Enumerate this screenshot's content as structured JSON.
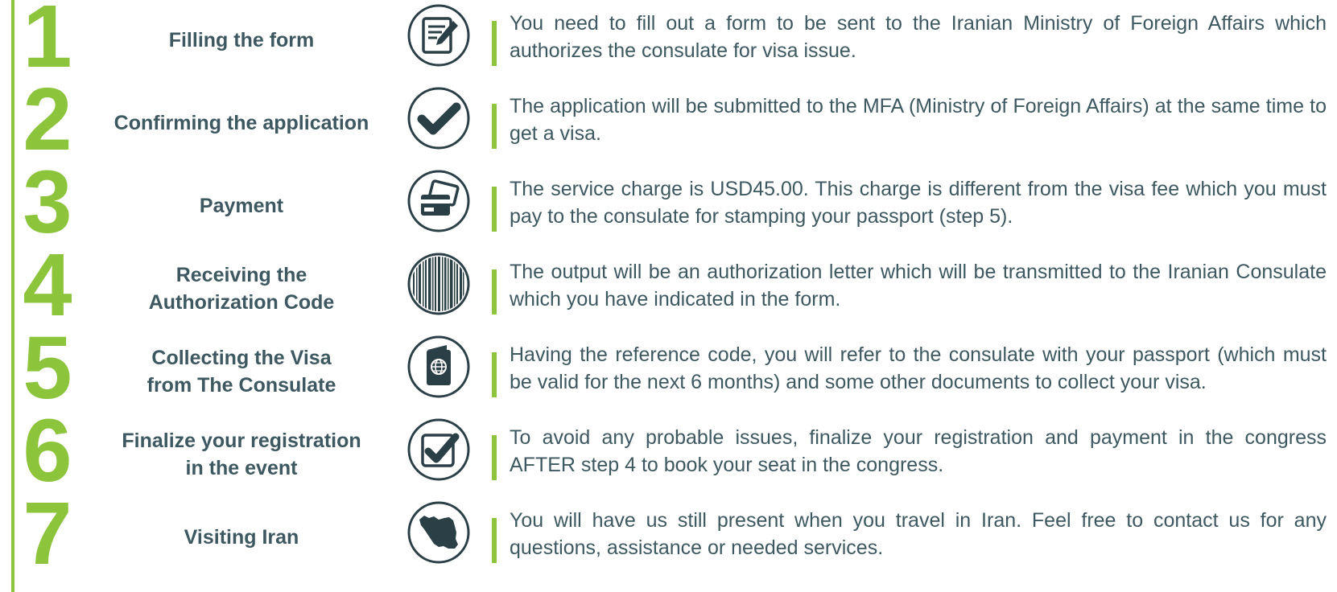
{
  "colors": {
    "accent": "#8cc43c",
    "text": "#3d5860",
    "icon": "#2b3f47"
  },
  "steps": [
    {
      "number": "1",
      "title": "Filling the form",
      "icon": "form-pen-icon",
      "description": "You need to fill out a form to be sent to the Iranian Ministry of Foreign Affairs which authorizes the consulate for visa issue."
    },
    {
      "number": "2",
      "title": "Confirming the application",
      "icon": "checkmark-circle-icon",
      "description": "The application will be submitted to the MFA (Ministry of Foreign Affairs) at the same time to get a visa."
    },
    {
      "number": "3",
      "title": "Payment",
      "icon": "credit-card-icon",
      "description": "The service charge is USD45.00. This charge is different from the visa fee which you must pay to the consulate for stamping your passport (step 5)."
    },
    {
      "number": "4",
      "title": "Receiving the\nAuthorization Code",
      "icon": "barcode-icon",
      "description": "The output will be an authorization letter which will be transmitted to the Iranian Consulate which you have indicated in the form."
    },
    {
      "number": "5",
      "title": "Collecting the Visa\nfrom The Consulate",
      "icon": "passport-icon",
      "description": "Having the reference code, you will refer to the consulate with your passport (which must be valid for the next 6 months) and some other documents to collect your visa."
    },
    {
      "number": "6",
      "title": "Finalize your registration\nin the event",
      "icon": "checkbox-icon",
      "description": "To avoid any probable issues, finalize your registration and payment in the congress AFTER step 4 to book your seat in the congress."
    },
    {
      "number": "7",
      "title": "Visiting Iran",
      "icon": "iran-map-icon",
      "description": "You will have us still present when you travel in Iran. Feel free to contact us for any questions, assistance or needed services."
    }
  ]
}
